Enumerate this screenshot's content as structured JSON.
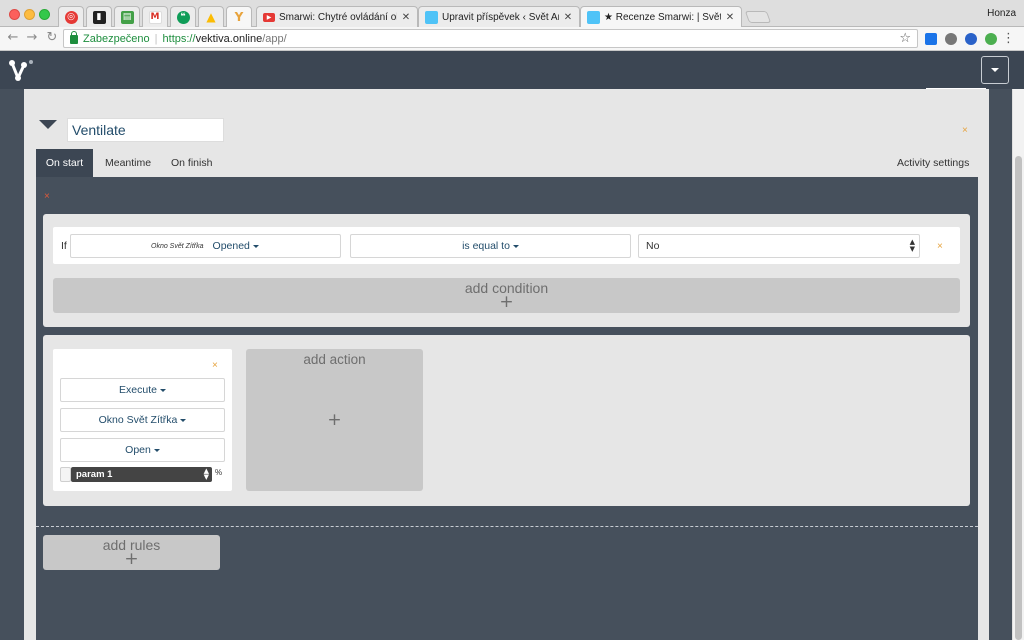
{
  "browser": {
    "user": "Honza",
    "pinned_tabs": [
      {
        "icon": "target-icon",
        "color": "#e53935"
      },
      {
        "icon": "board-icon",
        "color": "#222222"
      },
      {
        "icon": "sheet-icon",
        "color": "#43a047"
      },
      {
        "icon": "gmail-icon",
        "color": "#d93025"
      },
      {
        "icon": "hangouts-icon",
        "color": "#0f9d58"
      },
      {
        "icon": "drive-icon",
        "color": "#fbbc04"
      },
      {
        "icon": "vektiva-icon",
        "color": "#e8a33c"
      }
    ],
    "tabs": [
      {
        "title": "Smarwi: Chytré ovládání oken",
        "icon": "youtube-icon",
        "color": "#e53935"
      },
      {
        "title": "Upravit příspěvek ‹ Svět Andr",
        "icon": "site-icon",
        "color": "#4fc3f7"
      },
      {
        "title": "★ Recenze Smarwi: | Svět Andr",
        "icon": "site-icon",
        "color": "#4fc3f7"
      }
    ],
    "secure_label": "Zabezpečeno",
    "url_scheme": "https://",
    "url_host": "vektiva.online",
    "url_path": "/app/"
  },
  "activity": {
    "name": "Ventilate",
    "close_symbol": "×",
    "tabs": [
      "On start",
      "Meantime",
      "On finish"
    ],
    "settings_label": "Activity settings"
  },
  "condition": {
    "if_label": "If",
    "device": "Okno Svět Zítřka",
    "state": "Opened",
    "operator": "is equal to",
    "value": "No",
    "add_label": "add condition"
  },
  "action": {
    "command": "Execute",
    "device": "Okno Svět Zítřka",
    "operation": "Open",
    "param": "param 1",
    "param_unit": "%",
    "add_label": "add action"
  },
  "rules": {
    "add_label": "add rules"
  },
  "plus_symbol": "+"
}
